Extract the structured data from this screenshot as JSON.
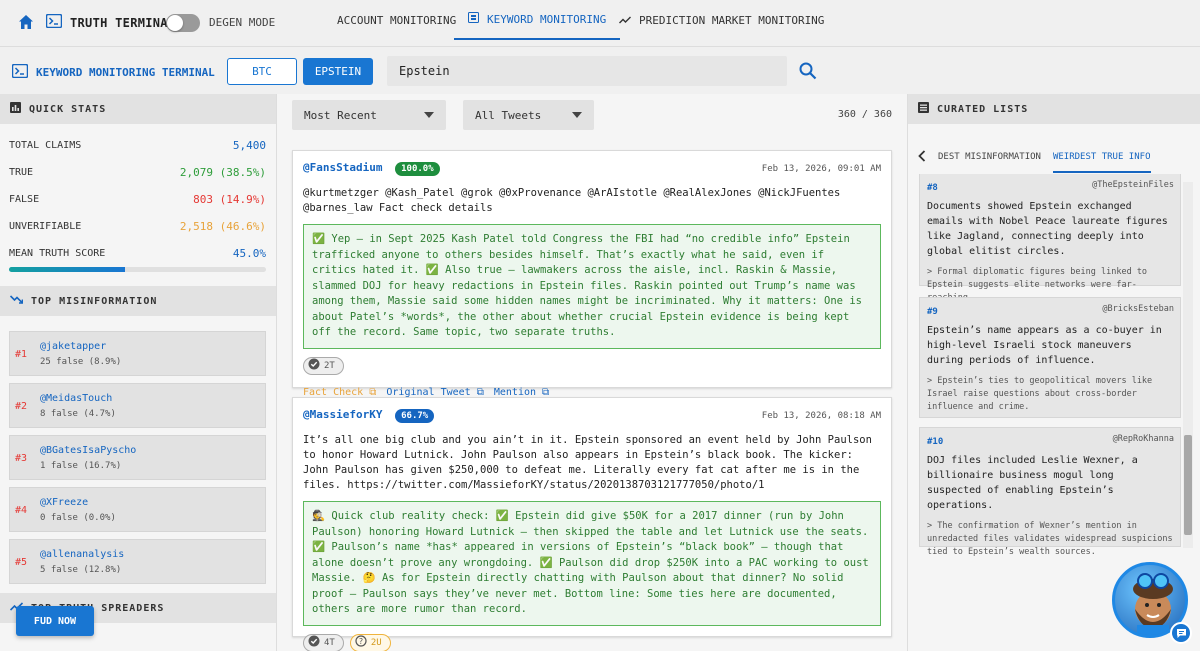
{
  "topnav": {
    "brand": "TRUTH TERMINAL",
    "degen_mode": "DEGEN MODE",
    "tabs": [
      {
        "label": "ACCOUNT MONITORING"
      },
      {
        "label": "KEYWORD MONITORING",
        "active": true
      },
      {
        "label": "PREDICTION MARKET MONITORING"
      }
    ]
  },
  "subhead": {
    "title": "KEYWORD MONITORING TERMINAL",
    "keywords": [
      "BTC",
      "EPSTEIN"
    ],
    "search_value": "Epstein"
  },
  "quick_stats": {
    "title": "QUICK STATS",
    "rows": [
      {
        "label": "TOTAL CLAIMS",
        "value": "5,400",
        "color": "#1565c0"
      },
      {
        "label": "TRUE",
        "value": "2,079 (38.5%)",
        "color": "#2e9d3a"
      },
      {
        "label": "FALSE",
        "value": "803 (14.9%)",
        "color": "#e53935"
      },
      {
        "label": "UNVERIFIABLE",
        "value": "2,518 (46.6%)",
        "color": "#e8a33a"
      },
      {
        "label": "MEAN TRUTH SCORE",
        "value": "45.0%",
        "color": "#1565c0"
      }
    ],
    "mean_truth_fraction": 0.45
  },
  "top_misinformation": {
    "title": "TOP MISINFORMATION",
    "items": [
      {
        "rank": "#1",
        "handle": "@jaketapper",
        "count": "25 false (8.9%)"
      },
      {
        "rank": "#2",
        "handle": "@MeidasTouch",
        "count": "8 false (4.7%)"
      },
      {
        "rank": "#3",
        "handle": "@BGatesIsaPyscho",
        "count": "1 false (16.7%)"
      },
      {
        "rank": "#4",
        "handle": "@XFreeze",
        "count": "0 false (0.0%)"
      },
      {
        "rank": "#5",
        "handle": "@allenanalysis",
        "count": "5 false (12.8%)"
      }
    ]
  },
  "top_truth_spreaders": {
    "title": "TOP TRUTH SPREADERS"
  },
  "fud_button": "FUD NOW",
  "feed": {
    "sort": "Most Recent",
    "filter": "All Tweets",
    "counter": "360 / 360",
    "posts": [
      {
        "handle": "@FansStadium",
        "score": "100.0%",
        "date": "Feb 13, 2026, 09:01 AM",
        "body": "@kurtmetzger @Kash_Patel @grok @0xProvenance @ArAIstotle @RealAlexJones @NickJFuentes @barnes_law Fact check details",
        "fact_check": "✅ Yep — in Sept 2025 Kash Patel told Congress the FBI had “no credible info” Epstein trafficked anyone to others besides himself. That’s exactly what he said, even if critics hated it. ✅ Also true — lawmakers across the aisle, incl. Raskin & Massie, slammed DOJ for heavy redactions in Epstein files. Raskin pointed out Trump’s name was among them, Massie said some hidden names might be incriminated. Why it matters: One is about Patel’s *words*, the other about whether crucial Epstein evidence is being kept off the record. Same topic, two separate truths.",
        "chips": [
          {
            "label": "2T",
            "kind": "true"
          }
        ],
        "links": [
          "Fact Check",
          "Original Tweet",
          "Mention"
        ]
      },
      {
        "handle": "@MassieforKY",
        "score": "66.7%",
        "date": "Feb 13, 2026, 08:18 AM",
        "body": "It’s all one big club and you ain’t in it. Epstein sponsored an event held by John Paulson to honor Howard Lutnick. John Paulson also appears in Epstein’s black book. The kicker: John Paulson has given $250,000 to defeat me. Literally every fat cat after me is in the files. https://twitter.com/MassieforKY/status/2020138703121777050/photo/1",
        "fact_check": "🕵️ Quick club reality check: ✅ Epstein did give $50K for a 2017 dinner (run by John Paulson) honoring Howard Lutnick — then skipped the table and let Lutnick use the seats. ✅ Paulson’s name *has* appeared in versions of Epstein’s “black book” — though that alone doesn’t prove any wrongdoing. ✅ Paulson did drop $250K into a PAC working to oust Massie. 🤔 As for Epstein directly chatting with Paulson about that dinner? No solid proof — Paulson says they’ve never met. Bottom line: Some ties here are documented, others are more rumor than record.",
        "chips": [
          {
            "label": "4T",
            "kind": "true"
          },
          {
            "label": "2U",
            "kind": "unverifiable"
          }
        ]
      }
    ]
  },
  "curated": {
    "title": "CURATED LISTS",
    "tabs": [
      "DEST MISINFORMATION",
      "WEIRDEST TRUE INFO"
    ],
    "items": [
      {
        "num": "#8",
        "source": "@TheEpsteinFiles",
        "text": "Documents showed Epstein exchanged emails with Nobel Peace laureate figures like Jagland, connecting deeply into global elitist circles.",
        "note": "> Formal diplomatic figures being linked to Epstein suggests elite networks were far-reaching."
      },
      {
        "num": "#9",
        "source": "@BricksEsteban",
        "text": "Epstein’s name appears as a co-buyer in high-level Israeli stock maneuvers during periods of influence.",
        "note": "> Epstein’s ties to geopolitical movers like Israel raise questions about cross-border influence and crime."
      },
      {
        "num": "#10",
        "source": "@RepRoKhanna",
        "text": "DOJ files included Leslie Wexner, a billionaire business mogul long suspected of enabling Epstein’s operations.",
        "note": "> The confirmation of Wexner’s mention in unredacted files validates widespread suspicions tied to Epstein’s wealth sources."
      }
    ]
  }
}
